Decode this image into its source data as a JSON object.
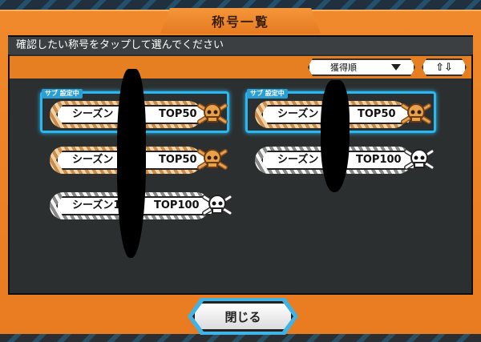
{
  "header": {
    "title": "称号一覧"
  },
  "subtitle": "確認したい称号をタップして選んでください",
  "sort": {
    "selected": "獲得順",
    "order_glyph": "⇧⇩"
  },
  "badges": {
    "left": [
      {
        "sub_label": "サブ 設定中",
        "left_text": "シーズン",
        "right_text": "TOP50",
        "tier": "gold"
      },
      {
        "left_text": "シーズン",
        "right_text": "TOP50",
        "tier": "gold"
      },
      {
        "left_text": "シーズン1",
        "right_text": "TOP100",
        "tier": "white"
      }
    ],
    "right": [
      {
        "sub_label": "サブ 設定中",
        "left_text": "シーズン",
        "right_text": "TOP50",
        "tier": "gold"
      },
      {
        "left_text": "シーズン",
        "right_text": "TOP100",
        "tier": "white"
      }
    ]
  },
  "footer": {
    "close_label": "閉じる"
  },
  "colors": {
    "accent": "#e97b21",
    "highlight": "#2ab8f0",
    "panel": "#2b2f30"
  }
}
